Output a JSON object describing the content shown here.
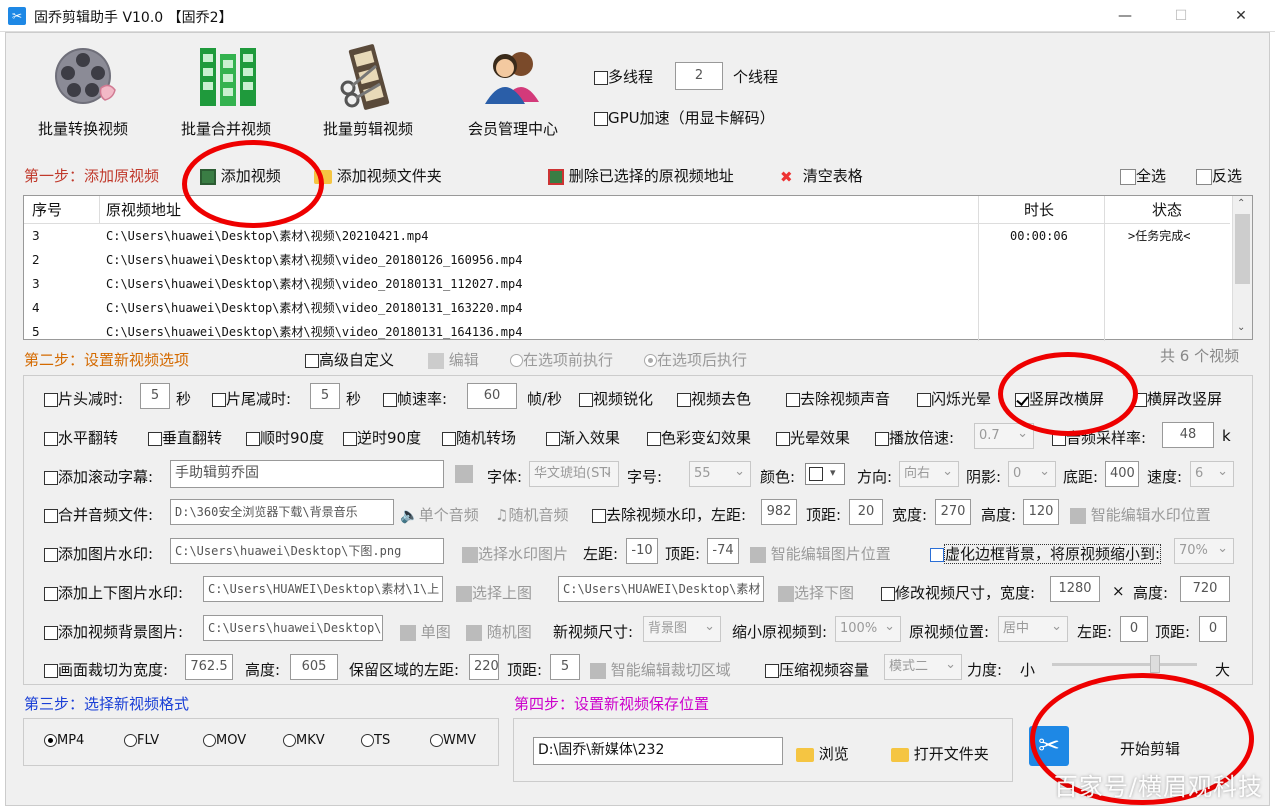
{
  "window": {
    "title": "固乔剪辑助手 V10.0 【固乔2】",
    "minimize": "—",
    "maximize": "☐",
    "close": "✕"
  },
  "toolbar": {
    "batch_convert": "批量转换视频",
    "batch_merge": "批量合并视频",
    "batch_edit": "批量剪辑视频",
    "member_center": "会员管理中心",
    "multithread_label": "多线程",
    "multithread_checked": false,
    "thread_count": "2",
    "thread_unit": "个线程",
    "gpu_label": "GPU加速（用显卡解码）",
    "gpu_checked": false
  },
  "step1": {
    "title": "第一步：添加原视频",
    "add_video": "添加视频",
    "add_folder": "添加视频文件夹",
    "delete_selected": "删除已选择的原视频地址",
    "clear_table": "清空表格",
    "select_all": "全选",
    "invert": "反选"
  },
  "table": {
    "headers": {
      "index": "序号",
      "path": "原视频地址",
      "duration": "时长",
      "status": "状态"
    },
    "rows": [
      {
        "index": "3",
        "path": "C:\\Users\\huawei\\Desktop\\素材\\视频\\20210421.mp4",
        "duration": "00:00:06",
        "status": ">任务完成<"
      },
      {
        "index": "2",
        "path": "C:\\Users\\huawei\\Desktop\\素材\\视频\\video_20180126_160956.mp4",
        "duration": "",
        "status": ""
      },
      {
        "index": "3",
        "path": "C:\\Users\\huawei\\Desktop\\素材\\视频\\video_20180131_112027.mp4",
        "duration": "",
        "status": ""
      },
      {
        "index": "4",
        "path": "C:\\Users\\huawei\\Desktop\\素材\\视频\\video_20180131_163220.mp4",
        "duration": "",
        "status": ""
      },
      {
        "index": "5",
        "path": "C:\\Users\\huawei\\Desktop\\素材\\视频\\video_20180131_164136.mp4",
        "duration": "",
        "status": ""
      }
    ]
  },
  "step2": {
    "title": "第二步：设置新视频选项",
    "advanced_custom": "高级自定义",
    "edit": "编辑",
    "before_exec": "在选项前执行",
    "after_exec": "在选项后执行",
    "video_count": "共 6 个视频"
  },
  "opts": {
    "head_cut": "片头减时:",
    "head_cut_val": "5",
    "sec": "秒",
    "tail_cut": "片尾减时:",
    "tail_cut_val": "5",
    "fps": "帧速率:",
    "fps_val": "60",
    "fps_unit": "帧/秒",
    "sharpen": "视频锐化",
    "desaturate": "视频去色",
    "remove_audio": "去除视频声音",
    "flash": "闪烁光晕",
    "v2h": "竖屏改横屏",
    "h2v": "横屏改竖屏",
    "hflip": "水平翻转",
    "vflip": "垂直翻转",
    "rot_cw": "顺时90度",
    "rot_ccw": "逆时90度",
    "rand_trans": "随机转场",
    "fade_in": "渐入效果",
    "color_shift": "色彩变幻效果",
    "halo": "光晕效果",
    "speed": "播放倍速:",
    "speed_val": "0.7",
    "sample_rate": "音频采样率:",
    "sample_rate_val": "48",
    "sample_unit": "k",
    "scroll_sub": "添加滚动字幕:",
    "scroll_sub_val": "手助辑剪乔固",
    "font": "字体:",
    "font_val": "华文琥珀(STI",
    "font_size": "字号:",
    "font_size_val": "55",
    "color": "颜色:",
    "direction": "方向:",
    "direction_val": "向右",
    "shadow": "阴影:",
    "shadow_val": "0",
    "bottom": "底距:",
    "bottom_val": "400",
    "velocity": "速度:",
    "velocity_val": "6",
    "merge_audio": "合并音频文件:",
    "merge_audio_val": "D:\\360安全浏览器下载\\背景音乐",
    "single_audio": "单个音频",
    "rand_audio": "随机音频",
    "rm_watermark": "去除视频水印，左距:",
    "rm_left": "982",
    "top": "顶距:",
    "rm_top": "20",
    "width": "宽度:",
    "rm_width": "270",
    "height": "高度:",
    "rm_height": "120",
    "smart_wm": "智能编辑水印位置",
    "img_wm": "添加图片水印:",
    "img_wm_val": "C:\\Users\\huawei\\Desktop\\下图.png",
    "select_wm_img": "选择水印图片",
    "left": "左距:",
    "img_left": "-10",
    "img_top": "-74",
    "smart_img": "智能编辑图片位置",
    "blur_bg": "虚化边框背景，将原视频缩小到:",
    "blur_val": "70%",
    "tb_wm": "添加上下图片水印:",
    "tb_wm_top_val": "C:\\Users\\HUAWEI\\Desktop\\素材\\1\\上",
    "select_top": "选择上图",
    "tb_wm_bottom_val": "C:\\Users\\HUAWEI\\Desktop\\素材",
    "select_bottom": "选择下图",
    "resize": "修改视频尺寸，宽度:",
    "resize_w": "1280",
    "times": "×",
    "height2": "高度:",
    "resize_h": "720",
    "bg_img": "添加视频背景图片:",
    "bg_img_val": "C:\\Users\\huawei\\Desktop\\",
    "single_img": "单图",
    "rand_img": "随机图",
    "new_size": "新视频尺寸:",
    "new_size_val": "背景图",
    "shrink": "缩小原视频到:",
    "shrink_val": "100%",
    "orig_pos": "原视频位置:",
    "orig_pos_val": "居中",
    "bg_left": "0",
    "bg_top": "0",
    "crop": "画面裁切为宽度:",
    "crop_w": "762.5",
    "crop_h": "605",
    "keep_left": "保留区域的左距:",
    "keep_left_val": "220",
    "crop_top": "5",
    "smart_crop": "智能编辑裁切区域",
    "compress": "压缩视频容量",
    "compress_mode": "模式二",
    "strength": "力度:",
    "small": "小",
    "large": "大",
    "v2h_checked": true
  },
  "step3": {
    "title": "第三步：选择新视频格式",
    "formats": [
      "MP4",
      "FLV",
      "MOV",
      "MKV",
      "TS",
      "WMV"
    ],
    "selected": "MP4"
  },
  "step4": {
    "title": "第四步：设置新视频保存位置",
    "path": "D:\\固乔\\新媒体\\232",
    "browse": "浏览",
    "open_folder": "打开文件夹"
  },
  "start": "开始剪辑",
  "watermark": "百家号/横眉观科技",
  "colors": {
    "annotation_red": "#e00000",
    "step_red": "#c0392b",
    "step_blue": "#1a3fd6",
    "step_magenta": "#cc00cc"
  }
}
